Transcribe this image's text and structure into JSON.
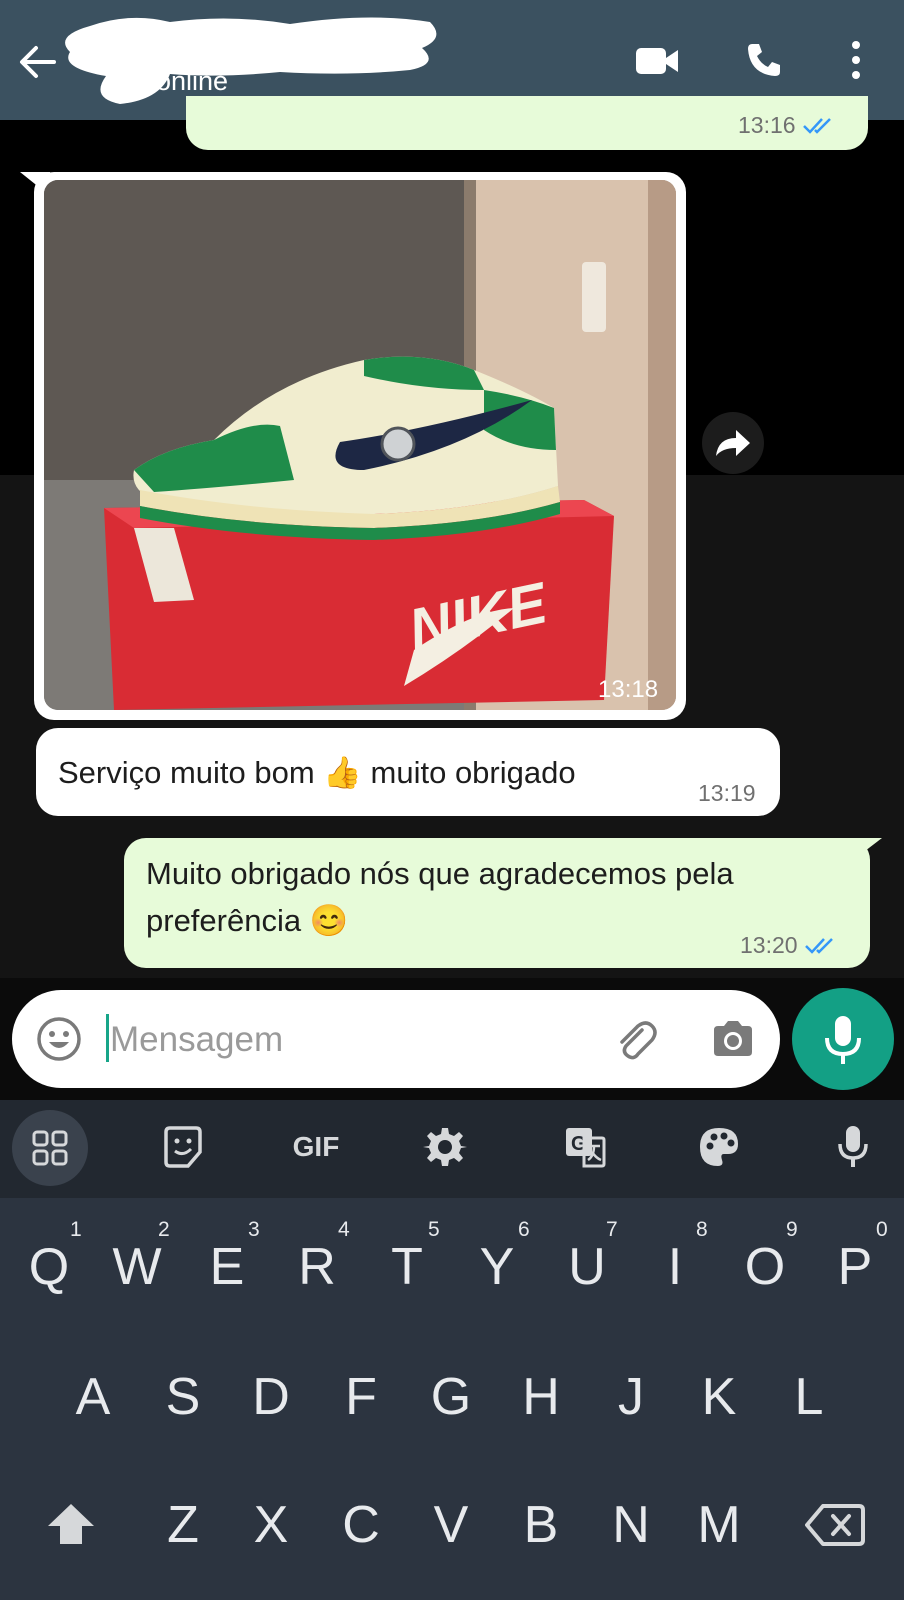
{
  "header": {
    "status": "online"
  },
  "messages": {
    "top_time": "13:16",
    "image_time": "13:18",
    "msg2": {
      "text": "Serviço muito bom 👍  muito obrigado",
      "time": "13:19"
    },
    "msg3": {
      "line1": "Muito obrigado nós que agradecemos pela",
      "line2": "preferência 😊",
      "time": "13:20"
    }
  },
  "composer": {
    "placeholder": "Mensagem"
  },
  "keyboard": {
    "toolbar_gif": "GIF",
    "row1": [
      "Q",
      "W",
      "E",
      "R",
      "T",
      "Y",
      "U",
      "I",
      "O",
      "P"
    ],
    "row1_nums": [
      "1",
      "2",
      "3",
      "4",
      "5",
      "6",
      "7",
      "8",
      "9",
      "0"
    ],
    "row2": [
      "A",
      "S",
      "D",
      "F",
      "G",
      "H",
      "J",
      "K",
      "L"
    ],
    "row3": [
      "Z",
      "X",
      "C",
      "V",
      "B",
      "N",
      "M"
    ]
  },
  "colors": {
    "header": "#3b5160",
    "outgoing_bubble": "#e7fbd9",
    "accent": "#13a085",
    "read_tick": "#3497f9"
  }
}
